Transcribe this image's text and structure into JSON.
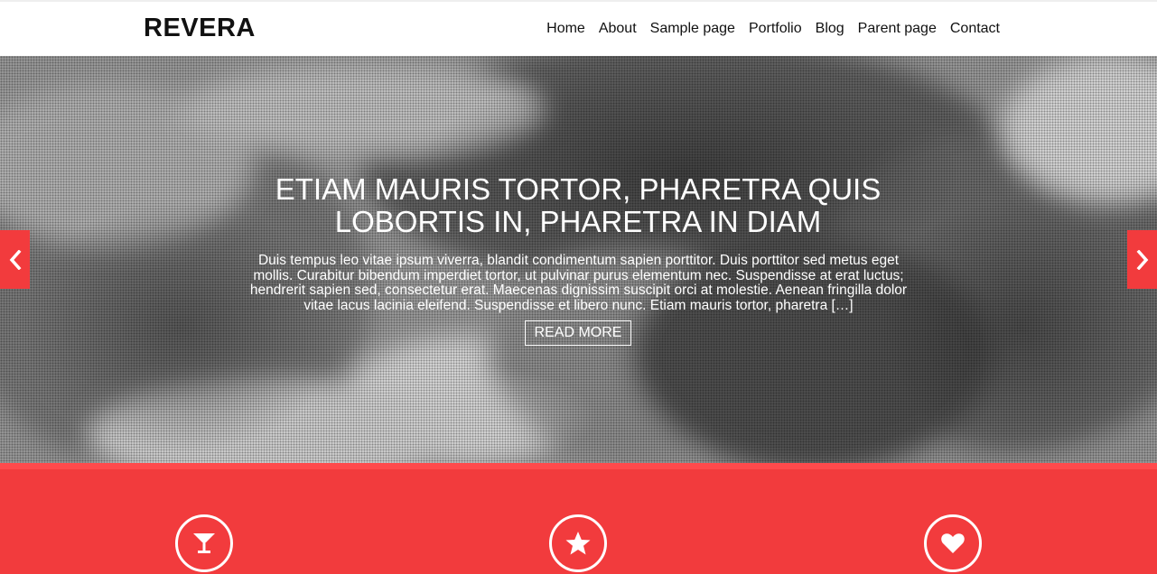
{
  "site": {
    "logo": "REVERA"
  },
  "nav": {
    "items": [
      "Home",
      "About",
      "Sample page",
      "Portfolio",
      "Blog",
      "Parent page",
      "Contact"
    ]
  },
  "hero": {
    "title": "ETIAM MAURIS TORTOR, PHARETRA QUIS LOBORTIS IN, PHARETRA IN DIAM",
    "excerpt": "Duis tempus leo vitae ipsum viverra, blandit condimentum sapien porttitor. Duis porttitor sed metus eget mollis. Curabitur bibendum imperdiet tortor, ut pulvinar purus elementum nec. Suspendisse at erat luctus; hendrerit sapien sed, consectetur erat. Maecenas dignissim suscipit orci at molestie. Aenean fringilla dolor vitae lacus lacinia eleifend. Suspendisse et libero nunc. Etiam mauris tortor, pharetra […]",
    "read_more": "READ MORE",
    "prev_icon": "chevron-left-icon",
    "next_icon": "chevron-right-icon"
  },
  "features": {
    "icons": [
      "cocktail-glass-icon",
      "star-icon",
      "heart-icon"
    ]
  },
  "colors": {
    "accent": "#f23b3d",
    "accent_light": "#ff4a4c",
    "text": "#111111",
    "white": "#ffffff"
  }
}
